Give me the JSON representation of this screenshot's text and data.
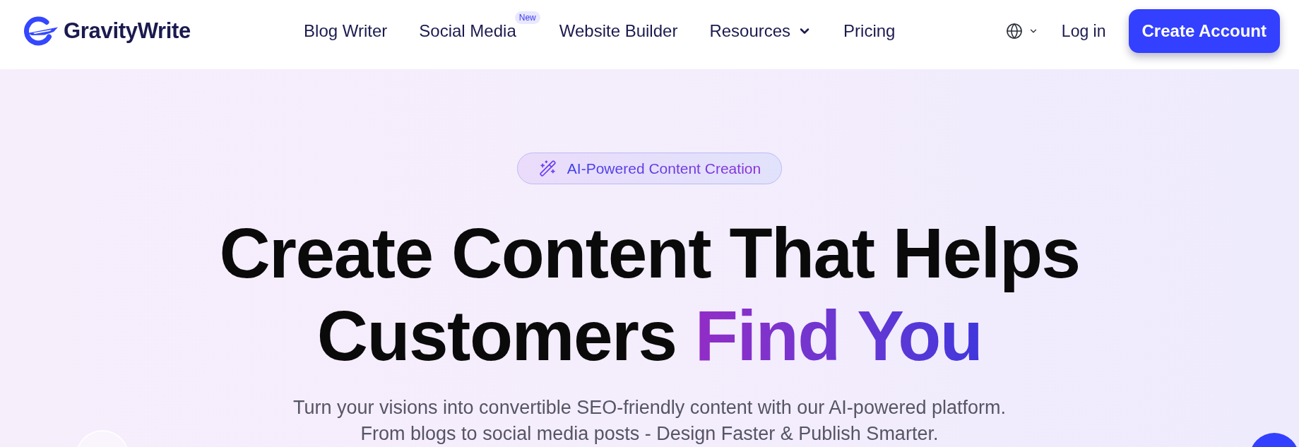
{
  "header": {
    "logo": "GravityWrite",
    "nav": [
      {
        "label": "Blog Writer",
        "dropdown": false
      },
      {
        "label": "Social Media",
        "dropdown": false,
        "badge": "New"
      },
      {
        "label": "Website Builder",
        "dropdown": false
      },
      {
        "label": "Resources",
        "dropdown": true
      },
      {
        "label": "Pricing",
        "dropdown": false
      }
    ],
    "login": "Log in",
    "cta": "Create Account"
  },
  "hero": {
    "badge": "AI-Powered Content Creation",
    "headline": "Create Content That Helps Customers",
    "highlight": "Find You",
    "subtitle": [
      "Turn your visions into convertible SEO-friendly content with our AI-powered platform.",
      "From blogs to social media posts - Design Faster & Publish Smarter."
    ]
  }
}
